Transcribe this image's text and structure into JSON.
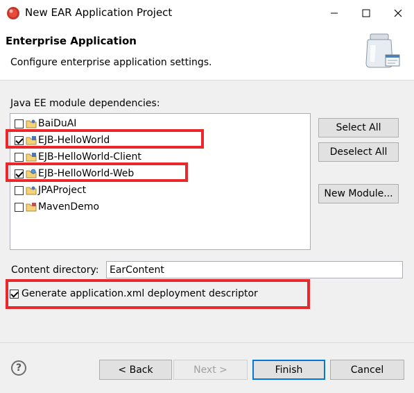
{
  "window": {
    "title": "New EAR Application Project"
  },
  "header": {
    "title": "Enterprise Application",
    "description": "Configure enterprise application settings."
  },
  "dependencies": {
    "label": "Java EE module dependencies:",
    "modules": [
      {
        "name": "BaiDuAI",
        "checked": false
      },
      {
        "name": "EJB-HelloWorld",
        "checked": true
      },
      {
        "name": "EJB-HelloWorld-Client",
        "checked": false
      },
      {
        "name": "EJB-HelloWorld-Web",
        "checked": true
      },
      {
        "name": "JPAProject",
        "checked": false
      },
      {
        "name": "MavenDemo",
        "checked": false
      }
    ]
  },
  "side_buttons": {
    "select_all": "Select All",
    "deselect_all": "Deselect All",
    "new_module": "New Module..."
  },
  "content_directory": {
    "label": "Content directory:",
    "value": "EarContent"
  },
  "generate_descriptor": {
    "label": "Generate application.xml deployment descriptor",
    "checked": true
  },
  "footer": {
    "help": "?",
    "back": "< Back",
    "next": "Next >",
    "finish": "Finish",
    "cancel": "Cancel"
  },
  "colors": {
    "highlight": "#e8282d",
    "default_button_border": "#0078d7"
  }
}
